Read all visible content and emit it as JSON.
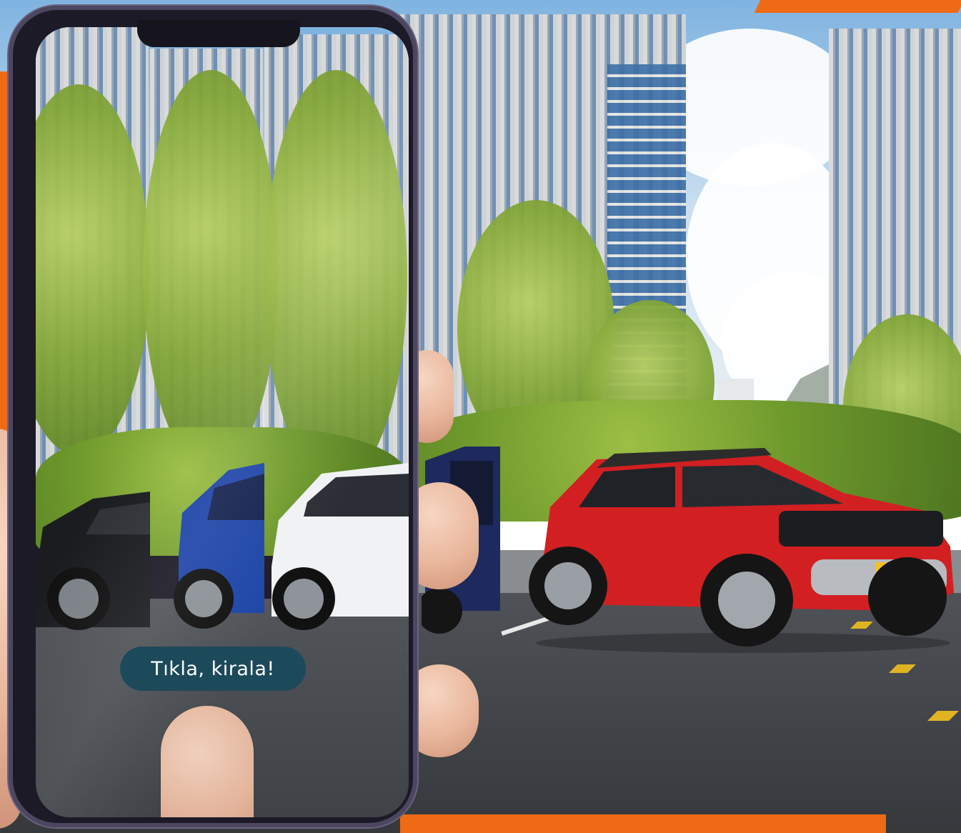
{
  "cta": {
    "label": "Tıkla, kirala!"
  },
  "colors": {
    "accent_orange": "#ee6a15",
    "cta_background": "#1d4a5b",
    "red_suv": "#d21f22",
    "blue_car": "#1e45a8",
    "white_car": "#f1f2f4",
    "black_car": "#1b1c1f",
    "road": "#45494d"
  },
  "icons": {
    "badge": "license-plate-logo"
  }
}
